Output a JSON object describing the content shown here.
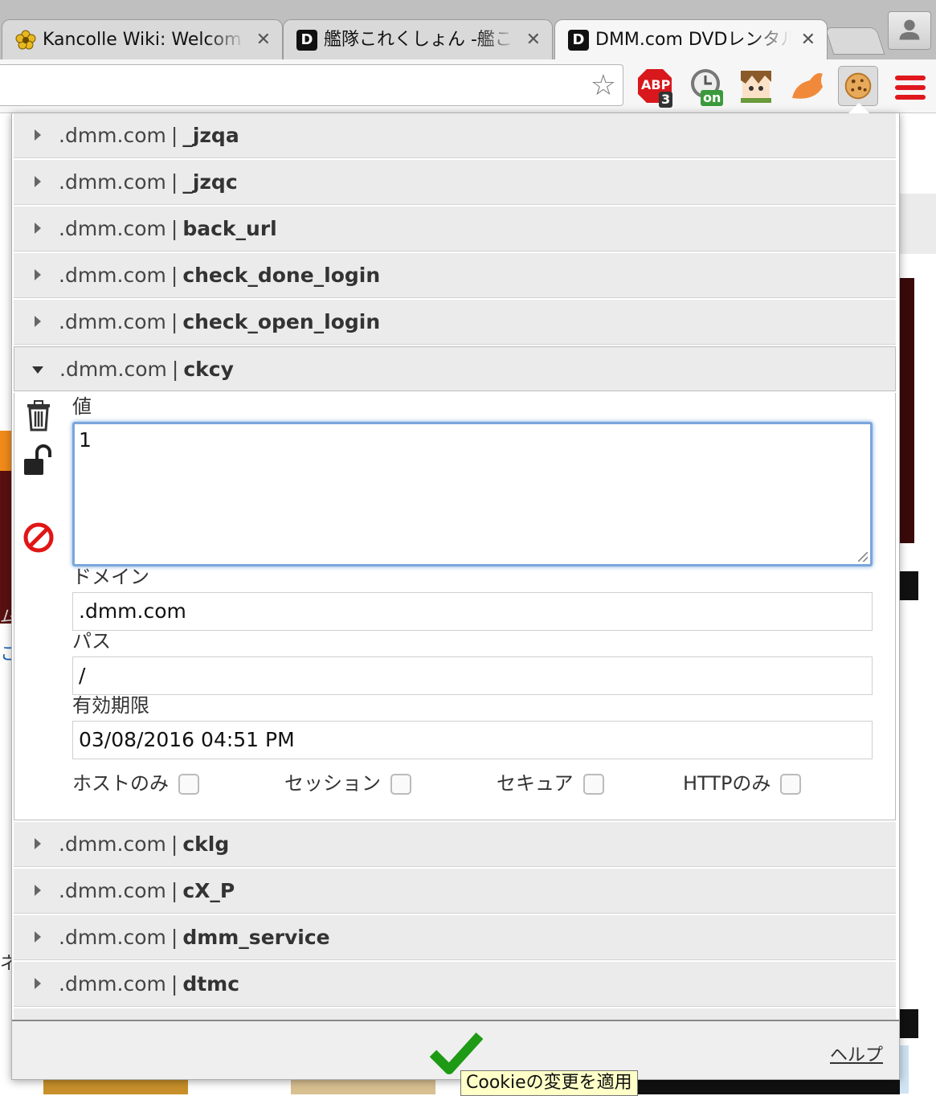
{
  "tabs": [
    {
      "title": "Kancolle Wiki: Welcom",
      "icon": "flower-favicon-icon",
      "close": "✕"
    },
    {
      "title": "艦隊これくしょん -艦こ",
      "icon": "dmm-favicon-icon",
      "close": "✕"
    },
    {
      "title": "DMM.com DVDレンタル",
      "icon": "dmm-favicon-icon",
      "close": "✕"
    }
  ],
  "toolbar": {
    "abp_label": "ABP",
    "abp_badge": "3",
    "timer_badge": "on"
  },
  "cookies": {
    "rows_before": [
      {
        "domain": ".dmm.com",
        "name": "_jzqa"
      },
      {
        "domain": ".dmm.com",
        "name": "_jzqc"
      },
      {
        "domain": ".dmm.com",
        "name": "back_url"
      },
      {
        "domain": ".dmm.com",
        "name": "check_done_login"
      },
      {
        "domain": ".dmm.com",
        "name": "check_open_login"
      }
    ],
    "expanded": {
      "domain": ".dmm.com",
      "name": "ckcy",
      "value_label": "値",
      "value": "1",
      "domain_label": "ドメイン",
      "domain_value": ".dmm.com",
      "path_label": "パス",
      "path_value": "/",
      "expiry_label": "有効期限",
      "expiry_value": "03/08/2016 04:51 PM",
      "options": [
        {
          "label": "ホストのみ",
          "checked": false
        },
        {
          "label": "セッション",
          "checked": false
        },
        {
          "label": "セキュア",
          "checked": false
        },
        {
          "label": "HTTPのみ",
          "checked": false
        }
      ]
    },
    "rows_after": [
      {
        "domain": ".dmm.com",
        "name": "cklg"
      },
      {
        "domain": ".dmm.com",
        "name": "cX_P"
      },
      {
        "domain": ".dmm.com",
        "name": "dmm_service"
      },
      {
        "domain": ".dmm.com",
        "name": "dtmc"
      }
    ],
    "separator": "|"
  },
  "footer": {
    "help_label": "ヘルプ",
    "apply_tooltip": "Cookieの変更を適用"
  },
  "background_text": {
    "edge_char_1": "こ",
    "edge_char_2": "ム",
    "edge_char_3": "ネ"
  },
  "colors": {
    "accent_blue": "#7aa6dc",
    "apply_green": "#1e9a14",
    "block_red": "#e01616",
    "menu_red": "#e0181d"
  }
}
